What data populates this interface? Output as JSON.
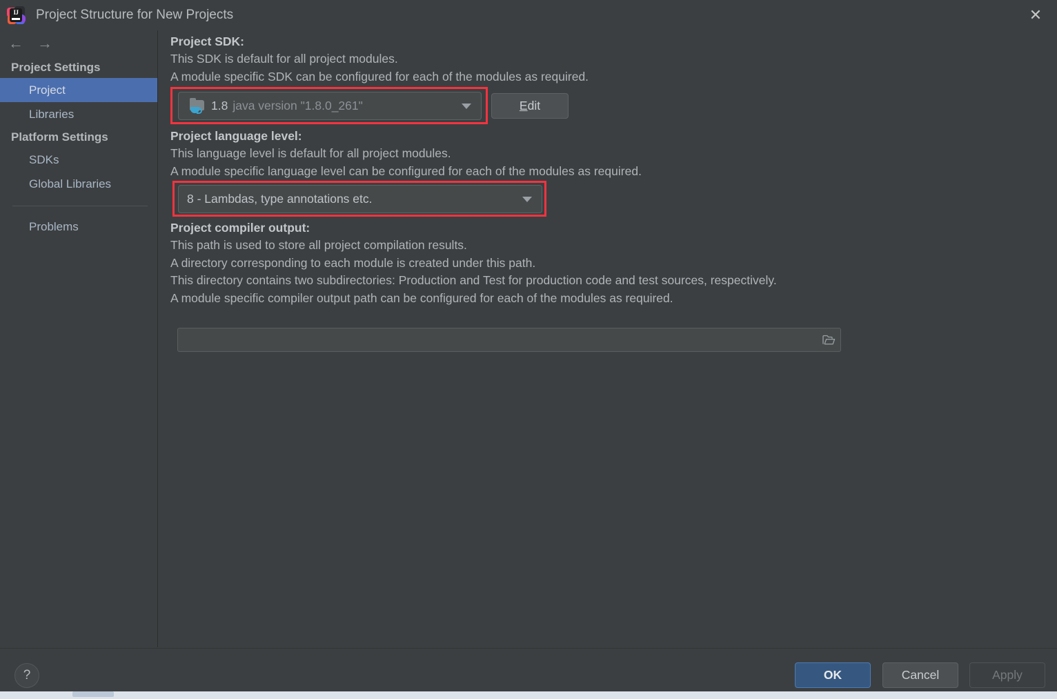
{
  "window": {
    "title": "Project Structure for New Projects",
    "logo_icon": "intellij-idea-logo",
    "logo_text": "IJ",
    "close_icon": "✕"
  },
  "sidebar": {
    "back_icon": "←",
    "forward_icon": "→",
    "groups": [
      {
        "label": "Project Settings",
        "items": [
          {
            "label": "Project",
            "selected": true
          },
          {
            "label": "Libraries",
            "selected": false
          }
        ]
      },
      {
        "label": "Platform Settings",
        "items": [
          {
            "label": "SDKs",
            "selected": false
          },
          {
            "label": "Global Libraries",
            "selected": false
          }
        ]
      }
    ],
    "extra_items": [
      {
        "label": "Problems",
        "selected": false
      }
    ]
  },
  "main": {
    "sdk": {
      "title": "Project SDK:",
      "desc1": "This SDK is default for all project modules.",
      "desc2": "A module specific SDK can be configured for each of the modules as required.",
      "icon": "java-sdk-folder-icon",
      "value_name": "1.8",
      "value_detail": "java version \"1.8.0_261\"",
      "edit_label_pre": "",
      "edit_label_mnemonic": "E",
      "edit_label_post": "dit",
      "highlighted": true
    },
    "language_level": {
      "title": "Project language level:",
      "desc1": "This language level is default for all project modules.",
      "desc2": "A module specific language level can be configured for each of the modules as required.",
      "value": "8 - Lambdas, type annotations etc.",
      "highlighted": true
    },
    "compiler_output": {
      "title": "Project compiler output:",
      "desc1": "This path is used to store all project compilation results.",
      "desc2": "A directory corresponding to each module is created under this path.",
      "desc3": "This directory contains two subdirectories: Production and Test for production code and test sources, respectively.",
      "desc4": "A module specific compiler output path can be configured for each of the modules as required.",
      "value": "",
      "placeholder": "",
      "browse_icon": "folder-open-icon"
    }
  },
  "footer": {
    "help_label": "?",
    "ok_label": "OK",
    "cancel_label": "Cancel",
    "apply_label": "Apply",
    "apply_disabled": true
  },
  "colors": {
    "dialog_bg": "#3c3f41",
    "selection_blue": "#4b6eaf",
    "primary_button": "#365880",
    "annotation_red": "#f5333f",
    "java_cup_blue": "#3ba5d1"
  }
}
